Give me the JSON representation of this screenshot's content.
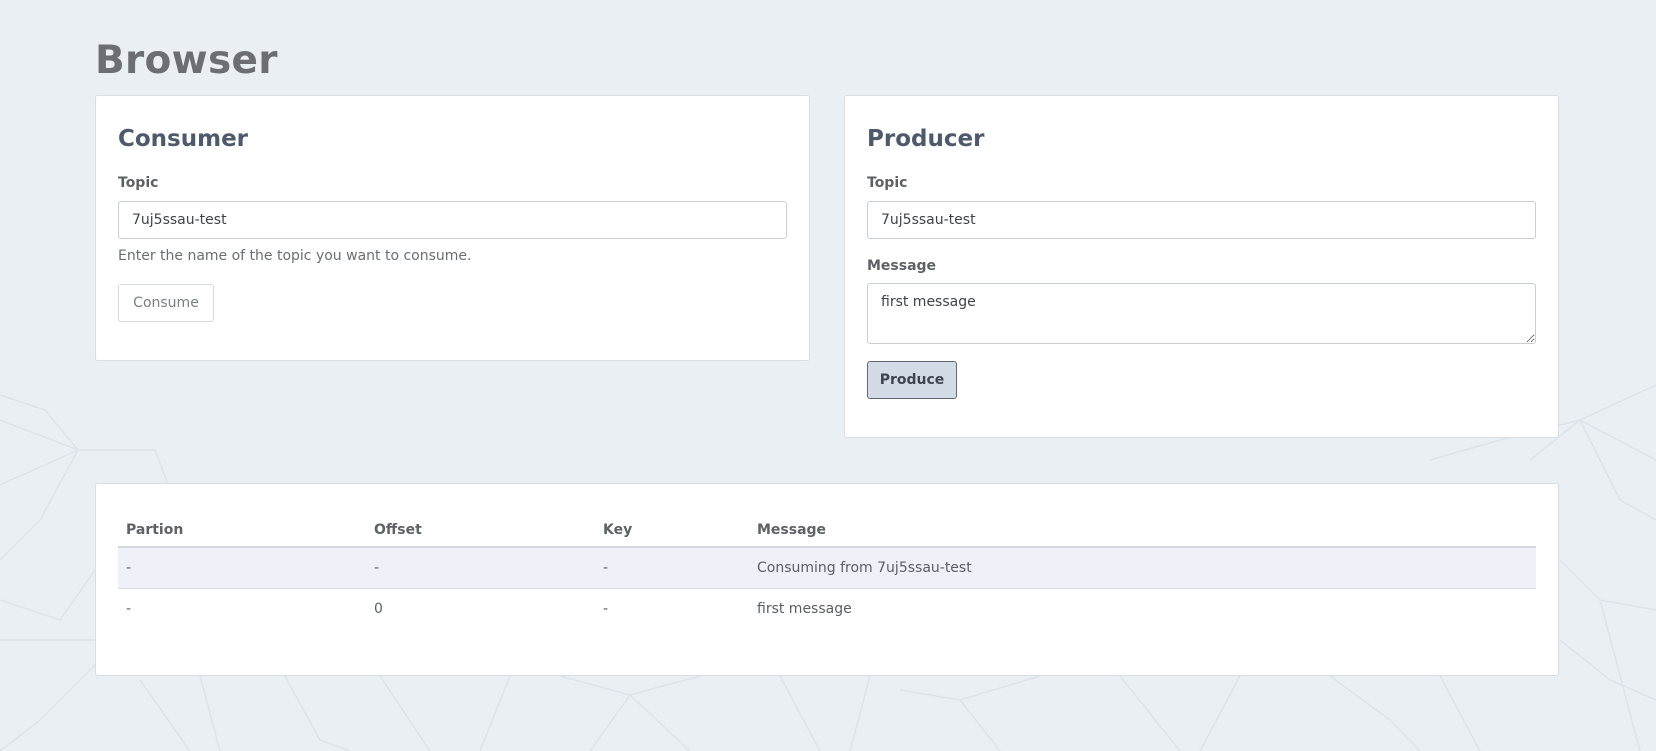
{
  "page": {
    "title": "Browser"
  },
  "consumer": {
    "title": "Consumer",
    "topic_label": "Topic",
    "topic_value": "7uj5ssau-test",
    "help_text": "Enter the name of the topic you want to consume.",
    "button_label": "Consume"
  },
  "producer": {
    "title": "Producer",
    "topic_label": "Topic",
    "topic_value": "7uj5ssau-test",
    "message_label": "Message",
    "message_value": "first message",
    "button_label": "Produce"
  },
  "results": {
    "columns": [
      "Partion",
      "Offset",
      "Key",
      "Message"
    ],
    "rows": [
      [
        "-",
        "-",
        "-",
        "Consuming from 7uj5ssau-test"
      ],
      [
        "-",
        "0",
        "-",
        "first message"
      ]
    ]
  },
  "colors": {
    "background": "#eaeff4",
    "card": "#ffffff",
    "accent_button": "#d3dbe6",
    "striped_row": "#eef2f8"
  }
}
